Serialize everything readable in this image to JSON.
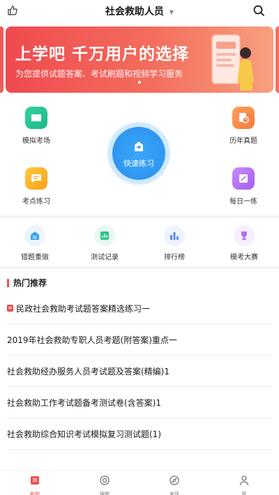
{
  "header": {
    "title": "社会救助人员"
  },
  "banner": {
    "title": "上学吧  千万用户的选择",
    "subtitle": "为您提供试题答案、考试刷题和视频学习服务"
  },
  "features": {
    "mock_exam": "模拟考场",
    "past_papers": "历年真题",
    "quick_practice": "快速练习",
    "point_practice": "考点练习",
    "daily_practice": "每日一练"
  },
  "secondary": {
    "wrong_redo": "错题重做",
    "test_records": "测试记录",
    "ranking": "排行榜",
    "mock_contest": "模考大赛"
  },
  "hot": {
    "title": "热门推荐",
    "items": [
      "民政社会救助考试题答案精选练习一",
      "2019年社会救助专职人员考题(附答案)重点一",
      "社会救助经办服务人员考试题及答案(精编)1",
      "社会救助工作考试题备考测试卷(含答案)1",
      "社会救助综合知识考试模拟复习测试题(1)"
    ]
  },
  "tabbar": {
    "home": "刷题",
    "search": "搜题",
    "discover": "发现",
    "me": "我"
  },
  "colors": {
    "accent": "#f05050",
    "quick_blue": "#2a8ef0"
  }
}
